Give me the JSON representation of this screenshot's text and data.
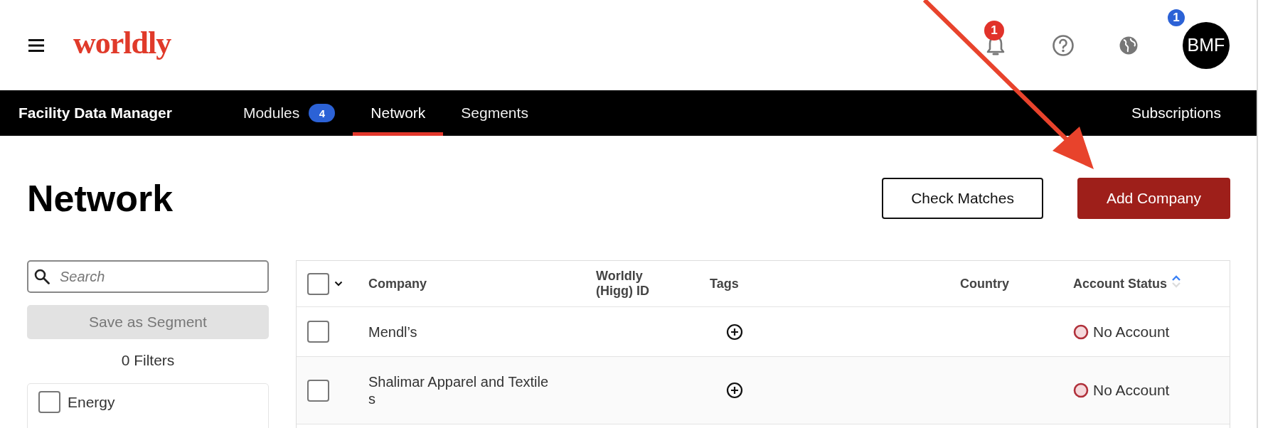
{
  "header": {
    "logo": "worldly",
    "notifications": {
      "count": "1"
    },
    "avatar": {
      "initials": "BMF",
      "badge": "1"
    }
  },
  "nav": {
    "title": "Facility Data Manager",
    "tabs": [
      {
        "label": "Modules",
        "badge": "4",
        "selected": false
      },
      {
        "label": "Network",
        "selected": true
      },
      {
        "label": "Segments",
        "selected": false
      }
    ],
    "right_link": "Subscriptions"
  },
  "page": {
    "title": "Network",
    "buttons": [
      {
        "label": "Check Matches",
        "kind": "secondary"
      },
      {
        "label": "Add Company",
        "kind": "primary"
      }
    ]
  },
  "sidebar": {
    "search": {
      "placeholder": "Search"
    },
    "save_button": {
      "label": "Save as Segment",
      "disabled": true
    },
    "filter_count": "0 Filters",
    "filters": [
      {
        "label": "Energy",
        "checked": false
      }
    ]
  },
  "table": {
    "select_all_checked": false,
    "columns": [
      {
        "label": "Company",
        "sorted": false
      },
      {
        "label": "Worldly (Higg) ID",
        "sorted": false
      },
      {
        "label": "Tags",
        "sorted": false
      },
      {
        "label": "Country",
        "sorted": false
      },
      {
        "label": "Account Status",
        "sorted": true
      }
    ],
    "rows": [
      {
        "checked": false,
        "company": "Mendl’s",
        "status": "No Account"
      },
      {
        "checked": false,
        "company": "Shalimar Apparel and Textiles",
        "status": "No Account"
      }
    ]
  },
  "annotation": {
    "kind": "arrow"
  }
}
